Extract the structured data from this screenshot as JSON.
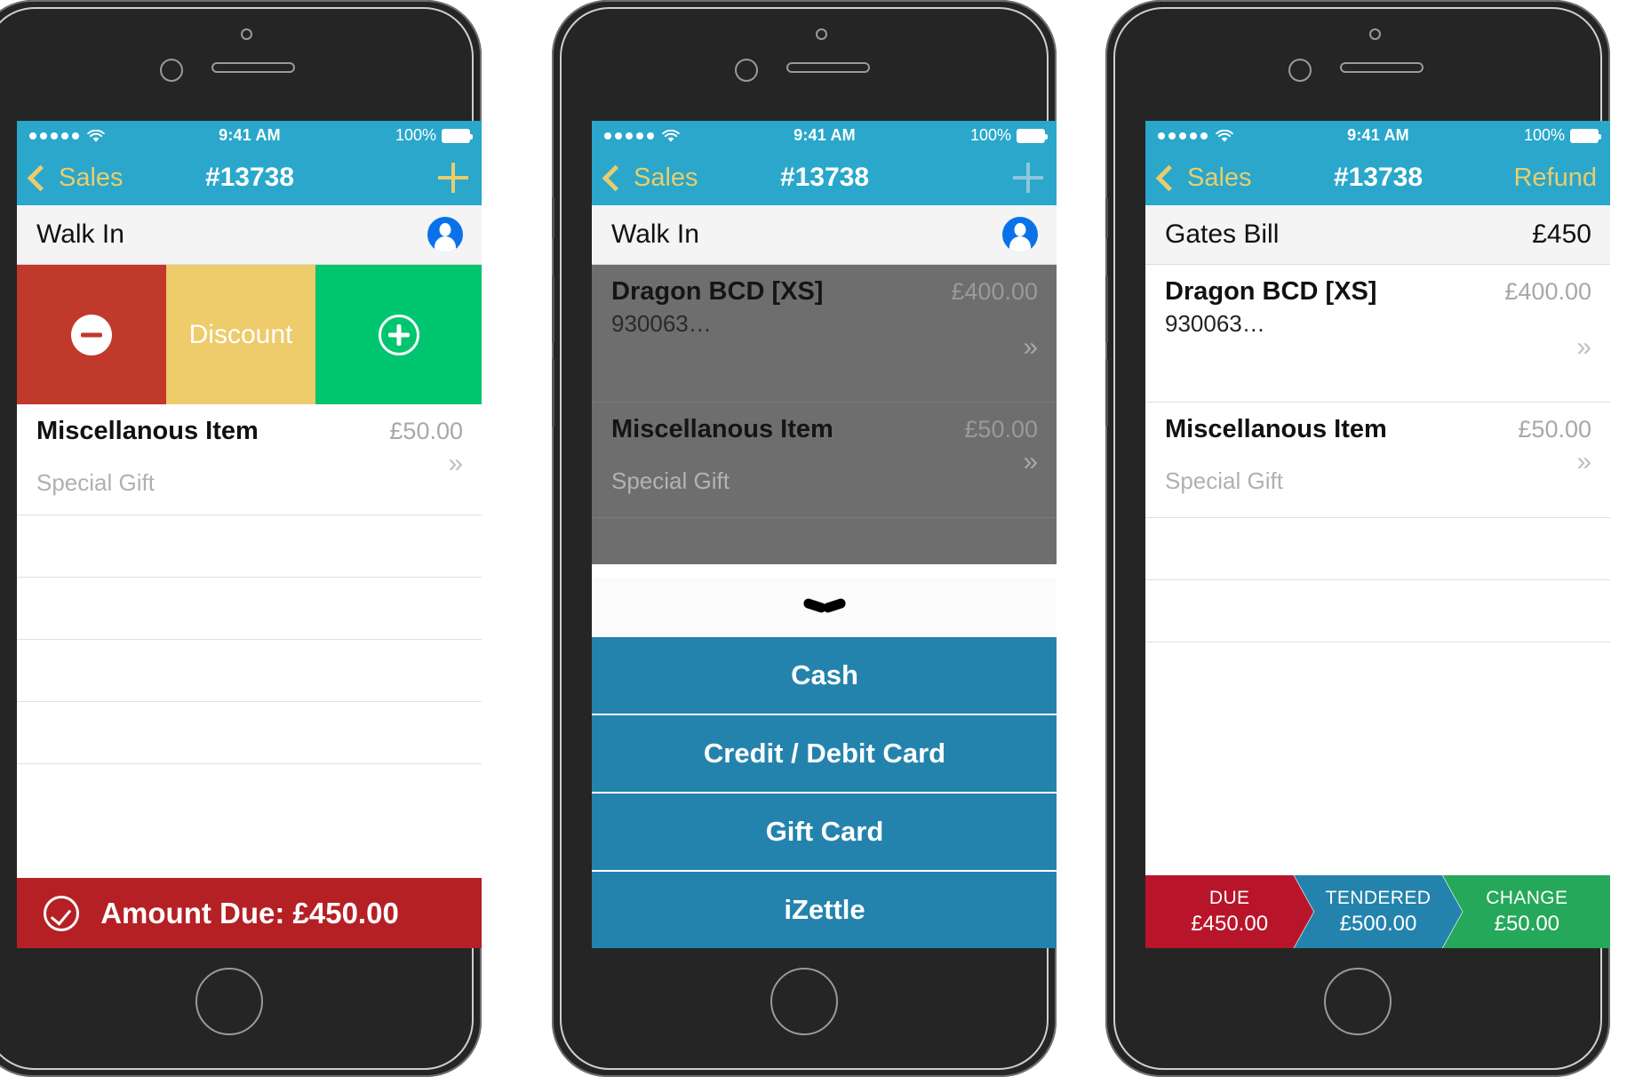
{
  "statusbar": {
    "time": "9:41 AM",
    "battery_percent": "100%",
    "signal_dots": 5,
    "wifi_icon": "wifi-icon",
    "battery_icon": "battery-full-icon"
  },
  "navbar": {
    "back_label": "Sales",
    "title": "#13738",
    "add_icon": "plus-icon",
    "refund_label": "Refund",
    "back_icon": "chevron-left-icon"
  },
  "phone1": {
    "customer": {
      "name": "Walk In",
      "avatar_icon": "person-avatar-icon"
    },
    "swipe_actions": {
      "decrease_icon": "minus-circle-icon",
      "discount_label": "Discount",
      "increase_icon": "plus-circle-icon",
      "decrease_color": "#c0392b",
      "discount_color": "#eecb6b",
      "increase_color": "#00c56f"
    },
    "items": [
      {
        "name": "Miscellanous Item",
        "price": "£50.00",
        "sku": "",
        "note": "Special Gift",
        "more_icon": "chevron-double-right-icon"
      }
    ],
    "footer": {
      "check_icon": "check-circle-icon",
      "label": "Amount Due: £450.00",
      "color": "#b52025"
    }
  },
  "phone2": {
    "customer": {
      "name": "Walk In",
      "avatar_icon": "person-avatar-icon"
    },
    "items": [
      {
        "name": "Dragon BCD [XS]",
        "price": "£400.00",
        "sku": "930063…",
        "note": "",
        "more_icon": "chevron-double-right-icon"
      },
      {
        "name": "Miscellanous Item",
        "price": "£50.00",
        "sku": "",
        "note": "Special Gift",
        "more_icon": "chevron-double-right-icon"
      }
    ],
    "payment_sheet": {
      "handle_icon": "chevron-down-handle-icon",
      "options": [
        "Cash",
        "Credit / Debit Card",
        "Gift Card",
        "iZettle"
      ],
      "button_color": "#2483ad"
    }
  },
  "phone3": {
    "customer": {
      "name": "Gates Bill",
      "amount": "£450"
    },
    "items": [
      {
        "name": "Dragon BCD [XS]",
        "price": "£400.00",
        "sku": "930063…",
        "note": "",
        "more_icon": "chevron-double-right-icon"
      },
      {
        "name": "Miscellanous Item",
        "price": "£50.00",
        "sku": "",
        "note": "Special Gift",
        "more_icon": "chevron-double-right-icon"
      }
    ],
    "totals": [
      {
        "label": "DUE",
        "value": "£450.00",
        "color": "#b8152b"
      },
      {
        "label": "TENDERED",
        "value": "£500.00",
        "color": "#2483ad"
      },
      {
        "label": "CHANGE",
        "value": "£50.00",
        "color": "#25a85a"
      }
    ]
  }
}
